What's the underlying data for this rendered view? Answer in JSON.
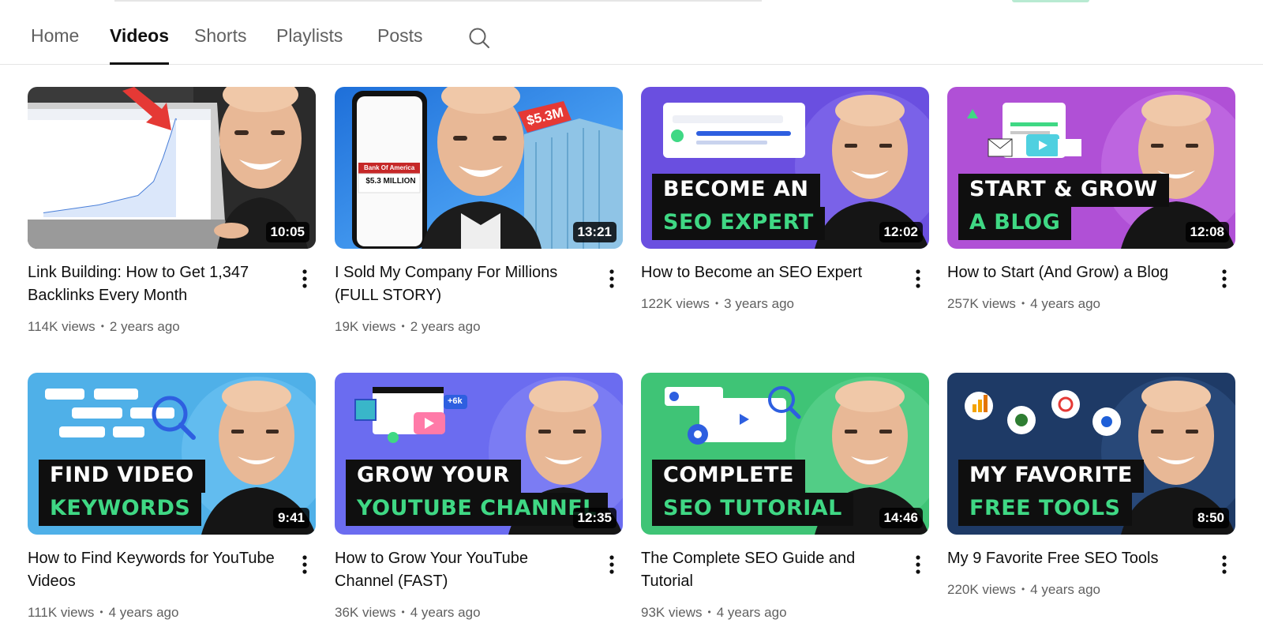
{
  "tabs": [
    {
      "label": "Home"
    },
    {
      "label": "Videos"
    },
    {
      "label": "Shorts"
    },
    {
      "label": "Playlists"
    },
    {
      "label": "Posts"
    }
  ],
  "active_tab": "Videos",
  "icons": {
    "search": "search-icon",
    "more": "more-vert-icon"
  },
  "videos": [
    {
      "title": "Link Building: How to Get 1,347 Backlinks Every Month",
      "views": "114K views",
      "age": "2 years ago",
      "duration": "10:05",
      "thumb_text": {
        "tag": "",
        "price": ""
      }
    },
    {
      "title": "I Sold My Company For Millions (FULL STORY)",
      "views": "19K views",
      "age": "2 years ago",
      "duration": "13:21",
      "thumb_text": {
        "tag": "$5.3M",
        "bank": "Bank Of America",
        "amount": "$5.3 MILLION"
      }
    },
    {
      "title": "How to Become an SEO Expert",
      "views": "122K views",
      "age": "3 years ago",
      "duration": "12:02",
      "thumb_text": {
        "line1": "BECOME AN",
        "line2": "SEO EXPERT"
      }
    },
    {
      "title": "How to Start (And Grow) a Blog",
      "views": "257K views",
      "age": "4 years ago",
      "duration": "12:08",
      "thumb_text": {
        "line1": "START & GROW",
        "line2": "A BLOG"
      }
    },
    {
      "title": "How to Find Keywords for YouTube Videos",
      "views": "111K views",
      "age": "4 years ago",
      "duration": "9:41",
      "thumb_text": {
        "line1": "FIND VIDEO",
        "line2": "KEYWORDS"
      }
    },
    {
      "title": "How to Grow Your YouTube Channel (FAST)",
      "views": "36K views",
      "age": "4 years ago",
      "duration": "12:35",
      "thumb_text": {
        "line1": "GROW YOUR",
        "line2": "YOUTUBE CHANNEL",
        "badge": "+6k"
      }
    },
    {
      "title": "The Complete SEO Guide and Tutorial",
      "views": "93K views",
      "age": "4 years ago",
      "duration": "14:46",
      "thumb_text": {
        "line1": "COMPLETE",
        "line2": "SEO TUTORIAL"
      }
    },
    {
      "title": "My 9 Favorite Free SEO Tools",
      "views": "220K views",
      "age": "4 years ago",
      "duration": "8:50",
      "thumb_text": {
        "line1": "MY FAVORITE",
        "line2": "FREE TOOLS"
      }
    }
  ],
  "colors": {
    "accent_green": "#3fd884",
    "text_primary": "#0f0f0f",
    "text_secondary": "#606060"
  }
}
